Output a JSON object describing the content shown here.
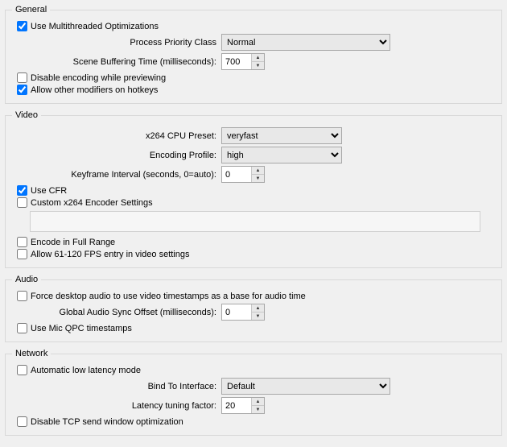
{
  "general": {
    "legend": "General",
    "multithreaded_label": "Use Multithreaded Optimizations",
    "multithreaded_checked": true,
    "priority_label": "Process Priority Class",
    "priority_value": "Normal",
    "buffering_label": "Scene Buffering Time (milliseconds):",
    "buffering_value": "700",
    "disable_preview_label": "Disable encoding while previewing",
    "disable_preview_checked": false,
    "allow_modifiers_label": "Allow other modifiers on hotkeys",
    "allow_modifiers_checked": true
  },
  "video": {
    "legend": "Video",
    "preset_label": "x264 CPU Preset:",
    "preset_value": "veryfast",
    "profile_label": "Encoding Profile:",
    "profile_value": "high",
    "keyframe_label": "Keyframe Interval (seconds, 0=auto):",
    "keyframe_value": "0",
    "use_cfr_label": "Use CFR",
    "use_cfr_checked": true,
    "custom_x264_label": "Custom x264 Encoder Settings",
    "custom_x264_checked": false,
    "full_range_label": "Encode in Full Range",
    "full_range_checked": false,
    "allow_fps_label": "Allow 61-120 FPS entry in video settings",
    "allow_fps_checked": false
  },
  "audio": {
    "legend": "Audio",
    "force_timestamps_label": "Force desktop audio to use video timestamps as a base for audio time",
    "force_timestamps_checked": false,
    "sync_offset_label": "Global Audio Sync Offset (milliseconds):",
    "sync_offset_value": "0",
    "mic_qpc_label": "Use Mic QPC timestamps",
    "mic_qpc_checked": false
  },
  "network": {
    "legend": "Network",
    "auto_low_latency_label": "Automatic low latency mode",
    "auto_low_latency_checked": false,
    "bind_label": "Bind To Interface:",
    "bind_value": "Default",
    "latency_label": "Latency tuning factor:",
    "latency_value": "20",
    "disable_tcp_label": "Disable TCP send window optimization",
    "disable_tcp_checked": false
  }
}
